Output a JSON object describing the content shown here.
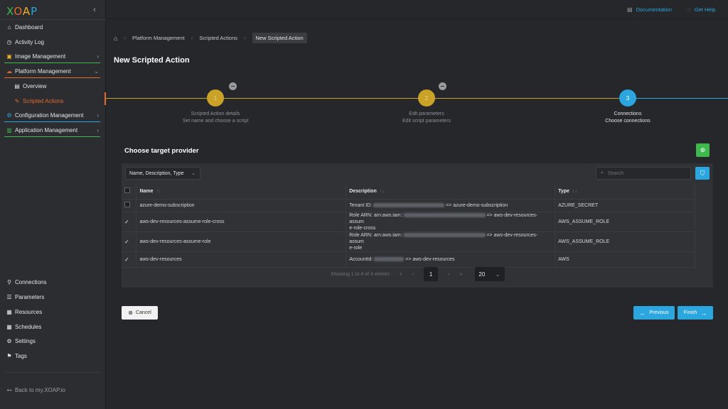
{
  "app": {
    "logo": [
      "X",
      "O",
      "A",
      "P"
    ]
  },
  "sidebar": {
    "collapse": "‹",
    "items": [
      {
        "label": "Dashboard"
      },
      {
        "label": "Activity Log"
      },
      {
        "label": "Image Management"
      },
      {
        "label": "Platform Management"
      },
      {
        "label": "Overview"
      },
      {
        "label": "Scripted Actions"
      },
      {
        "label": "Configuration Management"
      },
      {
        "label": "Application Management"
      }
    ],
    "bottom_items": [
      {
        "label": "Connections"
      },
      {
        "label": "Parameters"
      },
      {
        "label": "Resources"
      },
      {
        "label": "Schedules"
      },
      {
        "label": "Settings"
      },
      {
        "label": "Tags"
      }
    ],
    "back_link": "Back to my.XOAP.io"
  },
  "topbar": {
    "documentation": "Documentation",
    "help": "Get Help"
  },
  "breadcrumb": [
    "Platform Management",
    "Scripted Actions",
    "New Scripted Action"
  ],
  "page_title": "New Scripted Action",
  "stepper": [
    {
      "number": "1",
      "title": "Scripted Action details",
      "subtitle": "Set name and choose a script"
    },
    {
      "number": "2",
      "title": "Edit parameters",
      "subtitle": "Edit script parameters"
    },
    {
      "number": "3",
      "title": "Connections",
      "subtitle": "Choose connections"
    }
  ],
  "section_title": "Choose target provider",
  "filter": {
    "selected": "Name, Description, Type",
    "search_placeholder": "Search"
  },
  "table": {
    "headers": [
      "Name",
      "Description",
      "Type"
    ],
    "rows": [
      {
        "name": "azure-demo-subscription",
        "desc_prefix": "Tenant ID:",
        "desc_suffix": "=> azure-demo-subscription",
        "type": "AZURE_SECRET",
        "checked": false
      },
      {
        "name": "aws-dev-resources-assume-role-cross",
        "desc_prefix": "Role ARN: arn:aws:iam::",
        "desc_suffix": "=> aws-dev-resources-assum",
        "desc_line2": "e-role-cross",
        "type": "AWS_ASSUME_ROLE",
        "checked": true
      },
      {
        "name": "aws-dev-resources-assume-role",
        "desc_prefix": "Role ARN: arn:aws:iam::",
        "desc_suffix": "=> aws-dev-resources-assum",
        "desc_line2": "e-role",
        "type": "AWS_ASSUME_ROLE",
        "checked": true
      },
      {
        "name": "aws-dev-resources",
        "desc_prefix": "AccountId:",
        "desc_suffix": "=> aws-dev-resources",
        "type": "AWS",
        "checked": true
      }
    ]
  },
  "pager": {
    "summary": "Showing 1 to 4 of 4 entries",
    "current_page": "1",
    "page_size": "20"
  },
  "buttons": {
    "cancel": "Cancel",
    "previous": "Previous",
    "finish": "Finish"
  },
  "colors": {
    "accent": "#2ba6de",
    "orange": "#e46a2c",
    "gold": "#c9a227",
    "green": "#3db94e"
  }
}
